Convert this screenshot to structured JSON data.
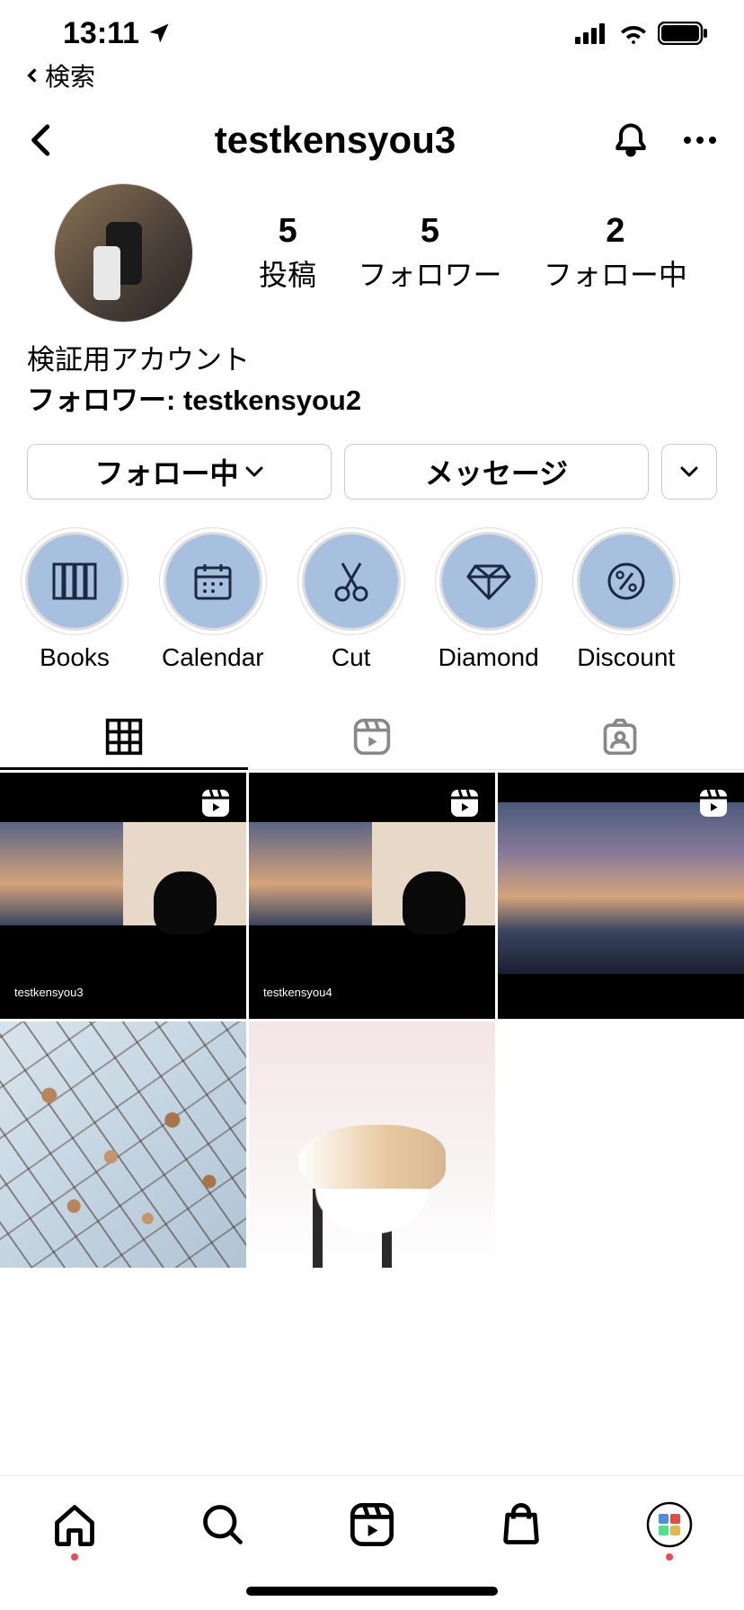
{
  "status": {
    "time": "13:11",
    "back_app": "検索"
  },
  "header": {
    "username": "testkensyou3"
  },
  "profile": {
    "stats": [
      {
        "count": "5",
        "label": "投稿"
      },
      {
        "count": "5",
        "label": "フォロワー"
      },
      {
        "count": "2",
        "label": "フォロー中"
      }
    ],
    "bio_name": "検証用アカウント",
    "follower_prefix": "フォロワー: ",
    "follower_name": "testkensyou2"
  },
  "actions": {
    "follow": "フォロー中",
    "message": "メッセージ"
  },
  "highlights": [
    {
      "label": "Books"
    },
    {
      "label": "Calendar"
    },
    {
      "label": "Cut"
    },
    {
      "label": "Diamond"
    },
    {
      "label": "Discount"
    }
  ],
  "grid": {
    "item0_user": "testkensyou3",
    "item1_user": "testkensyou4"
  }
}
